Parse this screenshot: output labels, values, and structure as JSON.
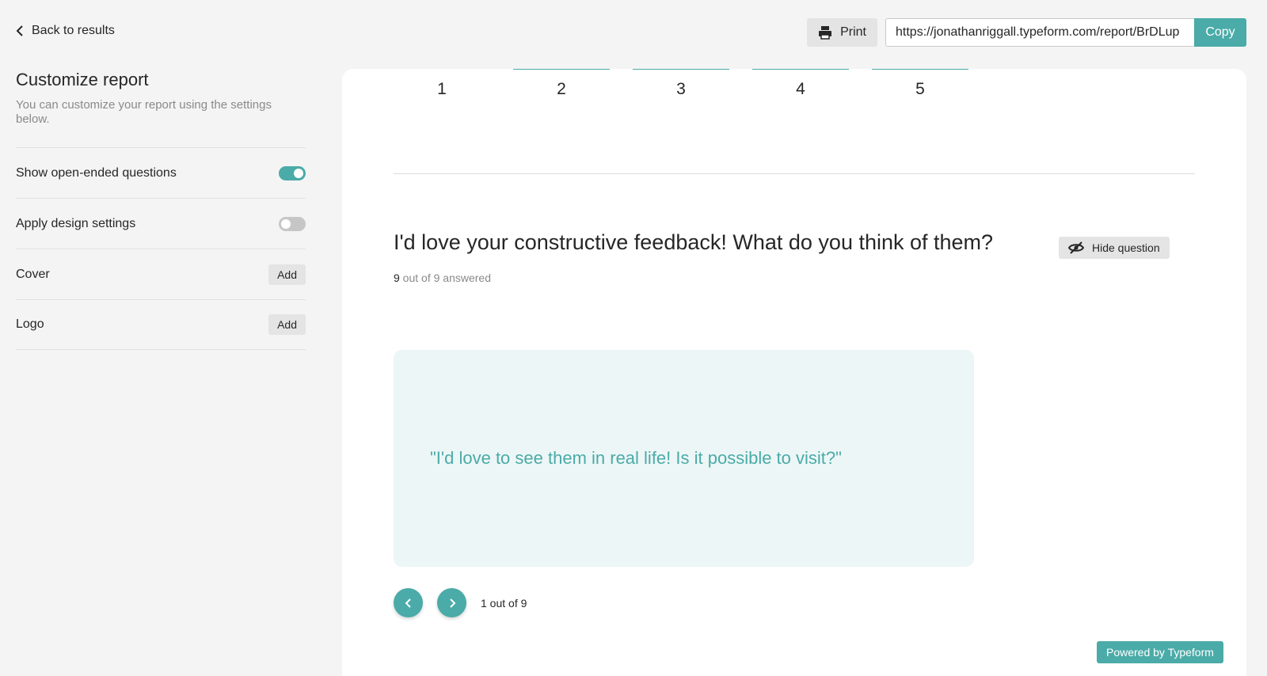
{
  "header": {
    "back_label": "Back to results",
    "print_label": "Print",
    "report_url": "https://jonathanriggall.typeform.com/report/BrDLup",
    "copy_label": "Copy"
  },
  "sidebar": {
    "title": "Customize report",
    "subtitle": "You can customize your report using the settings below.",
    "settings": [
      {
        "label": "Show open-ended questions",
        "control": "toggle",
        "state": "on"
      },
      {
        "label": "Apply design settings",
        "control": "toggle",
        "state": "off"
      },
      {
        "label": "Cover",
        "control": "button",
        "button_label": "Add"
      },
      {
        "label": "Logo",
        "control": "button",
        "button_label": "Add"
      }
    ]
  },
  "main": {
    "scale_labels": [
      "1",
      "2",
      "3",
      "4",
      "5"
    ],
    "question": {
      "title": "I'd love your constructive feedback! What do you think of them?",
      "answered_count": "9",
      "answered_suffix": " out of 9 answered",
      "hide_label": "Hide question"
    },
    "answer": {
      "text": "\"I'd love to see them in real life! Is it possible to visit?\""
    },
    "pager": {
      "label": "1 out of 9"
    },
    "powered_by": "Powered by Typeform"
  },
  "colors": {
    "accent": "#4aaba8",
    "background": "#f4f4f4",
    "answer_bg": "#edf6f6"
  }
}
